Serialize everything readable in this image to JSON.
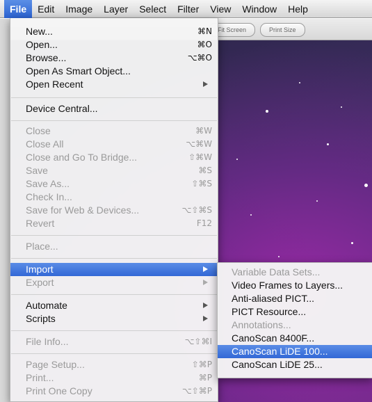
{
  "menubar": {
    "items": [
      "File",
      "Edit",
      "Image",
      "Layer",
      "Select",
      "Filter",
      "View",
      "Window",
      "Help"
    ]
  },
  "options_bar": {
    "buttons": [
      "Fit Screen",
      "Print Size"
    ]
  },
  "file_menu": {
    "items": [
      {
        "label": "New...",
        "shortcut": "⌘N",
        "disabled": false
      },
      {
        "label": "Open...",
        "shortcut": "⌘O",
        "disabled": false
      },
      {
        "label": "Browse...",
        "shortcut": "⌥⌘O",
        "disabled": false
      },
      {
        "label": "Open As Smart Object...",
        "shortcut": "",
        "disabled": false
      },
      {
        "label": "Open Recent",
        "shortcut": "",
        "disabled": false,
        "submenu": true
      },
      {
        "label": "Device Central...",
        "shortcut": "",
        "disabled": false
      },
      {
        "label": "Close",
        "shortcut": "⌘W",
        "disabled": true
      },
      {
        "label": "Close All",
        "shortcut": "⌥⌘W",
        "disabled": true
      },
      {
        "label": "Close and Go To Bridge...",
        "shortcut": "⇧⌘W",
        "disabled": true
      },
      {
        "label": "Save",
        "shortcut": "⌘S",
        "disabled": true
      },
      {
        "label": "Save As...",
        "shortcut": "⇧⌘S",
        "disabled": true
      },
      {
        "label": "Check In...",
        "shortcut": "",
        "disabled": true
      },
      {
        "label": "Save for Web & Devices...",
        "shortcut": "⌥⇧⌘S",
        "disabled": true
      },
      {
        "label": "Revert",
        "shortcut": "F12",
        "disabled": true
      },
      {
        "label": "Place...",
        "shortcut": "",
        "disabled": true
      },
      {
        "label": "Import",
        "shortcut": "",
        "disabled": false,
        "submenu": true,
        "highlighted": true
      },
      {
        "label": "Export",
        "shortcut": "",
        "disabled": true,
        "submenu": true
      },
      {
        "label": "Automate",
        "shortcut": "",
        "disabled": false,
        "submenu": true
      },
      {
        "label": "Scripts",
        "shortcut": "",
        "disabled": false,
        "submenu": true
      },
      {
        "label": "File Info...",
        "shortcut": "⌥⇧⌘I",
        "disabled": true
      },
      {
        "label": "Page Setup...",
        "shortcut": "⇧⌘P",
        "disabled": true
      },
      {
        "label": "Print...",
        "shortcut": "⌘P",
        "disabled": true
      },
      {
        "label": "Print One Copy",
        "shortcut": "⌥⇧⌘P",
        "disabled": true
      }
    ]
  },
  "import_menu": {
    "items": [
      {
        "label": "Variable Data Sets...",
        "disabled": true
      },
      {
        "label": "Video Frames to Layers...",
        "disabled": false
      },
      {
        "label": "Anti-aliased PICT...",
        "disabled": false
      },
      {
        "label": "PICT Resource...",
        "disabled": false
      },
      {
        "label": "Annotations...",
        "disabled": true
      },
      {
        "label": "CanoScan 8400F...",
        "disabled": false
      },
      {
        "label": "CanoScan LiDE 100...",
        "disabled": false,
        "highlighted": true
      },
      {
        "label": "CanoScan LiDE 25...",
        "disabled": false
      }
    ]
  }
}
